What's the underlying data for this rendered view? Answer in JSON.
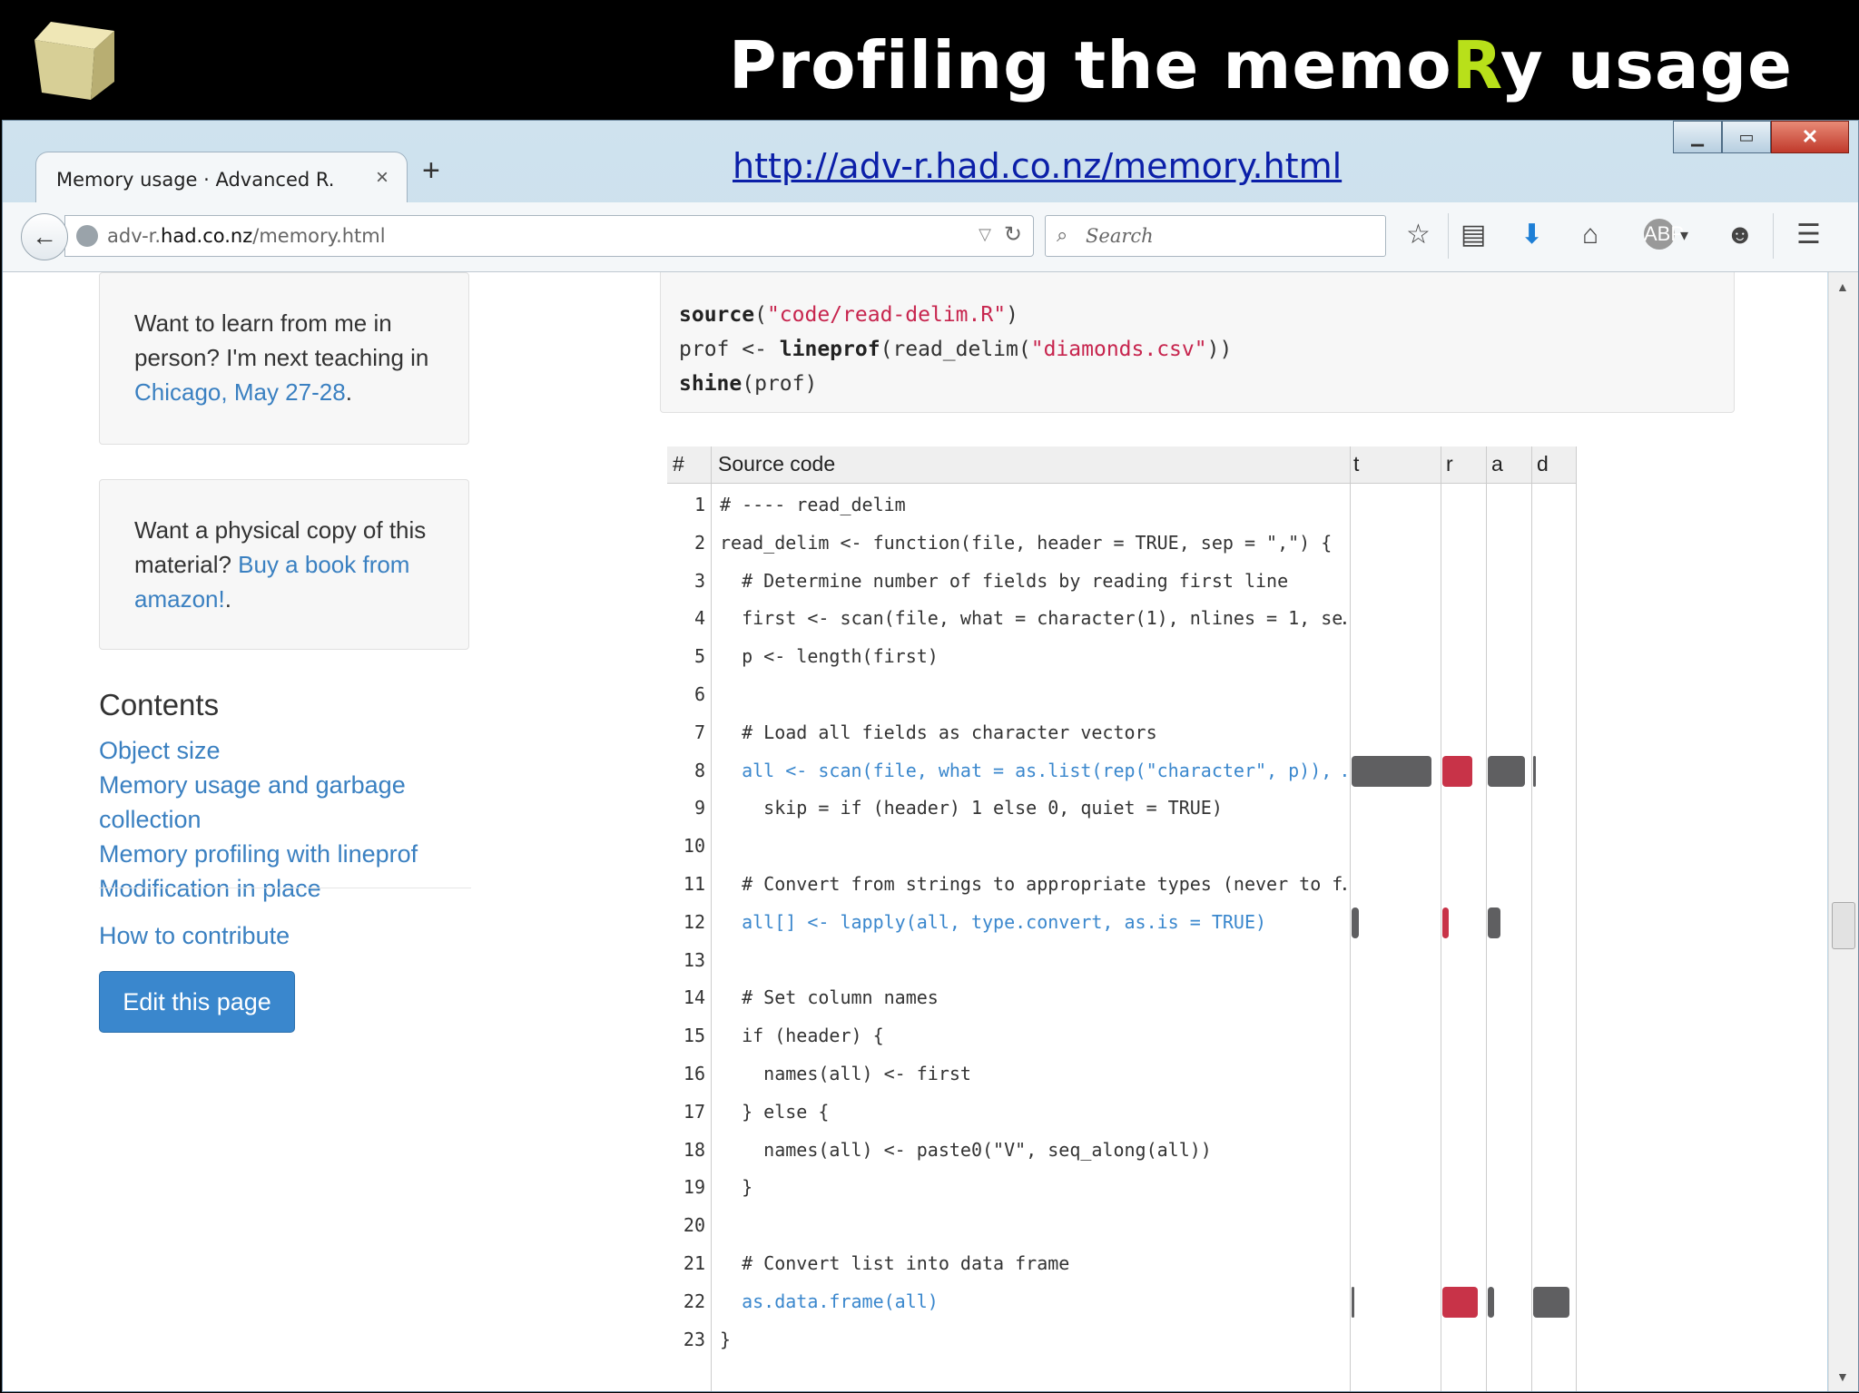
{
  "slide": {
    "title_pre": "Profiling the memo",
    "title_accent": "R",
    "title_post": "y usage"
  },
  "browser": {
    "tab_title": "Memory usage · Advanced R.",
    "overlay_url": "http://adv-r.had.co.nz/memory.html",
    "url_prefix": "adv-r.",
    "url_domain": "had.co.nz",
    "url_path": "/memory.html",
    "search_placeholder": "Search",
    "new_tab_label": "+",
    "close_symbol": "×",
    "icons": [
      "back-arrow-icon",
      "globe-icon",
      "reload-icon",
      "search-icon",
      "star-icon",
      "reader-icon",
      "download-icon",
      "home-icon",
      "adblock-icon",
      "hello-icon",
      "menu-icon"
    ]
  },
  "sidebar": {
    "box1": {
      "text": "Want to learn from me in person? I'm next teaching in ",
      "link": "Chicago, May 27-28",
      "end": "."
    },
    "box2": {
      "text": "Want a physical copy of this material? ",
      "link": "Buy a book from amazon!",
      "end": "."
    },
    "contents_heading": "Contents",
    "toc": [
      "Object size",
      "Memory usage and garbage collection",
      "Memory profiling with lineprof",
      "Modification in place"
    ],
    "contribute": "How to contribute",
    "edit_button": "Edit this page"
  },
  "code": {
    "l1_fn": "source",
    "l1_open": "(",
    "l1_str": "\"code/read-delim.R\"",
    "l1_close": ")",
    "l2_pre": "prof <- ",
    "l2_fn": "lineprof",
    "l2_mid": "(read_delim(",
    "l2_str": "\"diamonds.csv\"",
    "l2_close": "))",
    "l3_fn": "shine",
    "l3_rest": "(prof)"
  },
  "profile": {
    "headers": {
      "num": "#",
      "source": "Source code",
      "t": "t",
      "r": "r",
      "a": "a",
      "d": "d"
    },
    "rows": [
      {
        "n": "1",
        "code": "# ---- read_delim"
      },
      {
        "n": "2",
        "code": "read_delim <- function(file, header = TRUE, sep = \",\") {"
      },
      {
        "n": "3",
        "code": "  # Determine number of fields by reading first line"
      },
      {
        "n": "4",
        "code": "  first <- scan(file, what = character(1), nlines = 1, se…"
      },
      {
        "n": "5",
        "code": "  p <- length(first)"
      },
      {
        "n": "6",
        "code": ""
      },
      {
        "n": "7",
        "code": "  # Load all fields as character vectors"
      },
      {
        "n": "8",
        "code": "  all <- scan(file, what = as.list(rep(\"character\", p)), …"
      },
      {
        "n": "9",
        "code": "    skip = if (header) 1 else 0, quiet = TRUE)"
      },
      {
        "n": "10",
        "code": ""
      },
      {
        "n": "11",
        "code": "  # Convert from strings to appropriate types (never to f…"
      },
      {
        "n": "12",
        "code": "  all[] <- lapply(all, type.convert, as.is = TRUE)"
      },
      {
        "n": "13",
        "code": ""
      },
      {
        "n": "14",
        "code": "  # Set column names"
      },
      {
        "n": "15",
        "code": "  if (header) {"
      },
      {
        "n": "16",
        "code": "    names(all) <- first"
      },
      {
        "n": "17",
        "code": "  } else {"
      },
      {
        "n": "18",
        "code": "    names(all) <- paste0(\"V\", seq_along(all))"
      },
      {
        "n": "19",
        "code": "  }"
      },
      {
        "n": "20",
        "code": ""
      },
      {
        "n": "21",
        "code": "  # Convert list into data frame"
      },
      {
        "n": "22",
        "code": "  as.data.frame(all)"
      },
      {
        "n": "23",
        "code": "}"
      }
    ],
    "highlight_rows": [
      "8",
      "12",
      "22"
    ],
    "metrics": {
      "8": {
        "t": 0.92,
        "r": 0.72,
        "a": 0.9,
        "d": 0.05
      },
      "12": {
        "t": 0.08,
        "r": 0.15,
        "a": 0.3,
        "d": 0
      },
      "22": {
        "t": 0.02,
        "r": 0.85,
        "a": 0.16,
        "d": 0.88
      }
    },
    "colors": {
      "time": "#5f5f61",
      "released": "#c83348",
      "alloc": "#5f5f61",
      "dup": "#5f5f61",
      "link": "#3a80c1",
      "highlight_code": "#3a87cd"
    }
  }
}
